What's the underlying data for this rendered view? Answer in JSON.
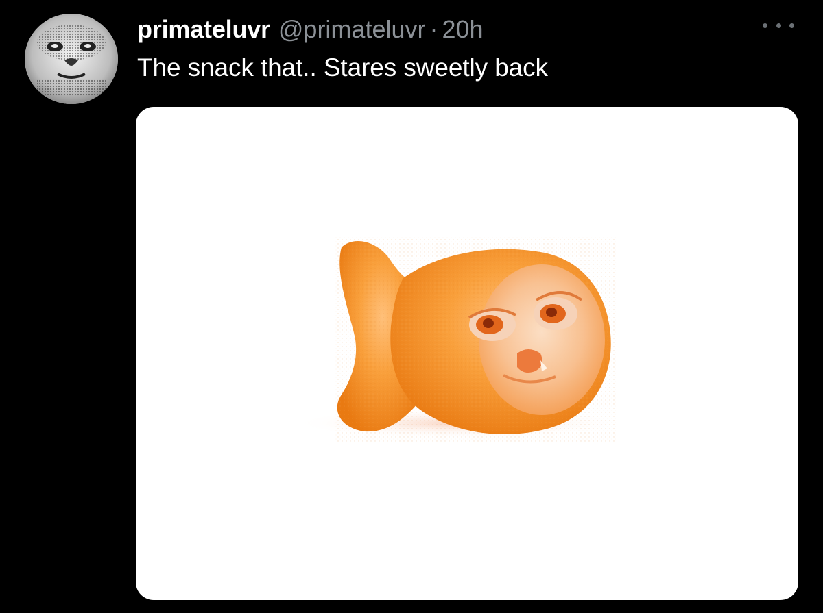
{
  "tweet": {
    "display_name": "primateluvr",
    "handle": "@primateluvr",
    "separator": "·",
    "time": "20h",
    "text": "The snack that.. Stares sweetly back",
    "more_icon": "more-horizontal-icon",
    "avatar": "ape-face-avatar",
    "media": "orange-fish-cracker-with-face"
  },
  "colors": {
    "background": "#000000",
    "name": "#ffffff",
    "meta": "#8b9096",
    "media_background": "#ffffff",
    "cracker": "#f5922a"
  }
}
